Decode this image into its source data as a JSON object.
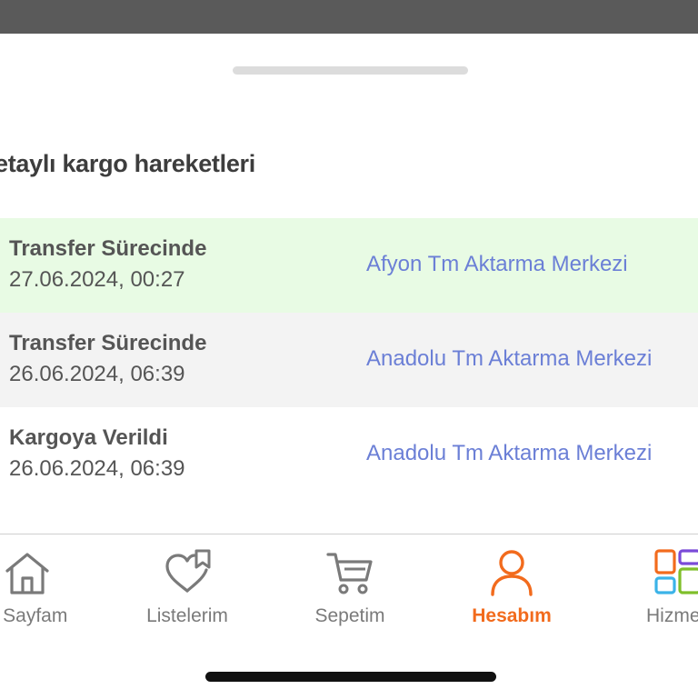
{
  "sheet": {
    "title": "etaylı kargo hareketleri"
  },
  "movements": [
    {
      "status": "Transfer Sürecinde",
      "date": "27.06.2024, 00:27",
      "location": "Afyon Tm Aktarma Merkezi",
      "highlight": "#e8fbe4"
    },
    {
      "status": "Transfer Sürecinde",
      "date": "26.06.2024, 06:39",
      "location": "Anadolu Tm Aktarma Merkezi",
      "highlight": "#f3f3f3"
    },
    {
      "status": "Kargoya Verildi",
      "date": "26.06.2024, 06:39",
      "location": "Anadolu Tm Aktarma Merkezi",
      "highlight": "#ffffff"
    }
  ],
  "tabbar": {
    "tabs": [
      {
        "label": "a Sayfam",
        "icon": "home-icon"
      },
      {
        "label": "Listelerim",
        "icon": "heart-bookmark-icon"
      },
      {
        "label": "Sepetim",
        "icon": "cart-icon"
      },
      {
        "label": "Hesabım",
        "icon": "user-icon",
        "active": true
      },
      {
        "label": "Hizmetl",
        "icon": "grid-services-icon"
      }
    ]
  },
  "colors": {
    "accent": "#f26b1d",
    "link": "#6b7fd6",
    "first_row_bg": "#e8fbe4",
    "second_row_bg": "#f3f3f3"
  }
}
